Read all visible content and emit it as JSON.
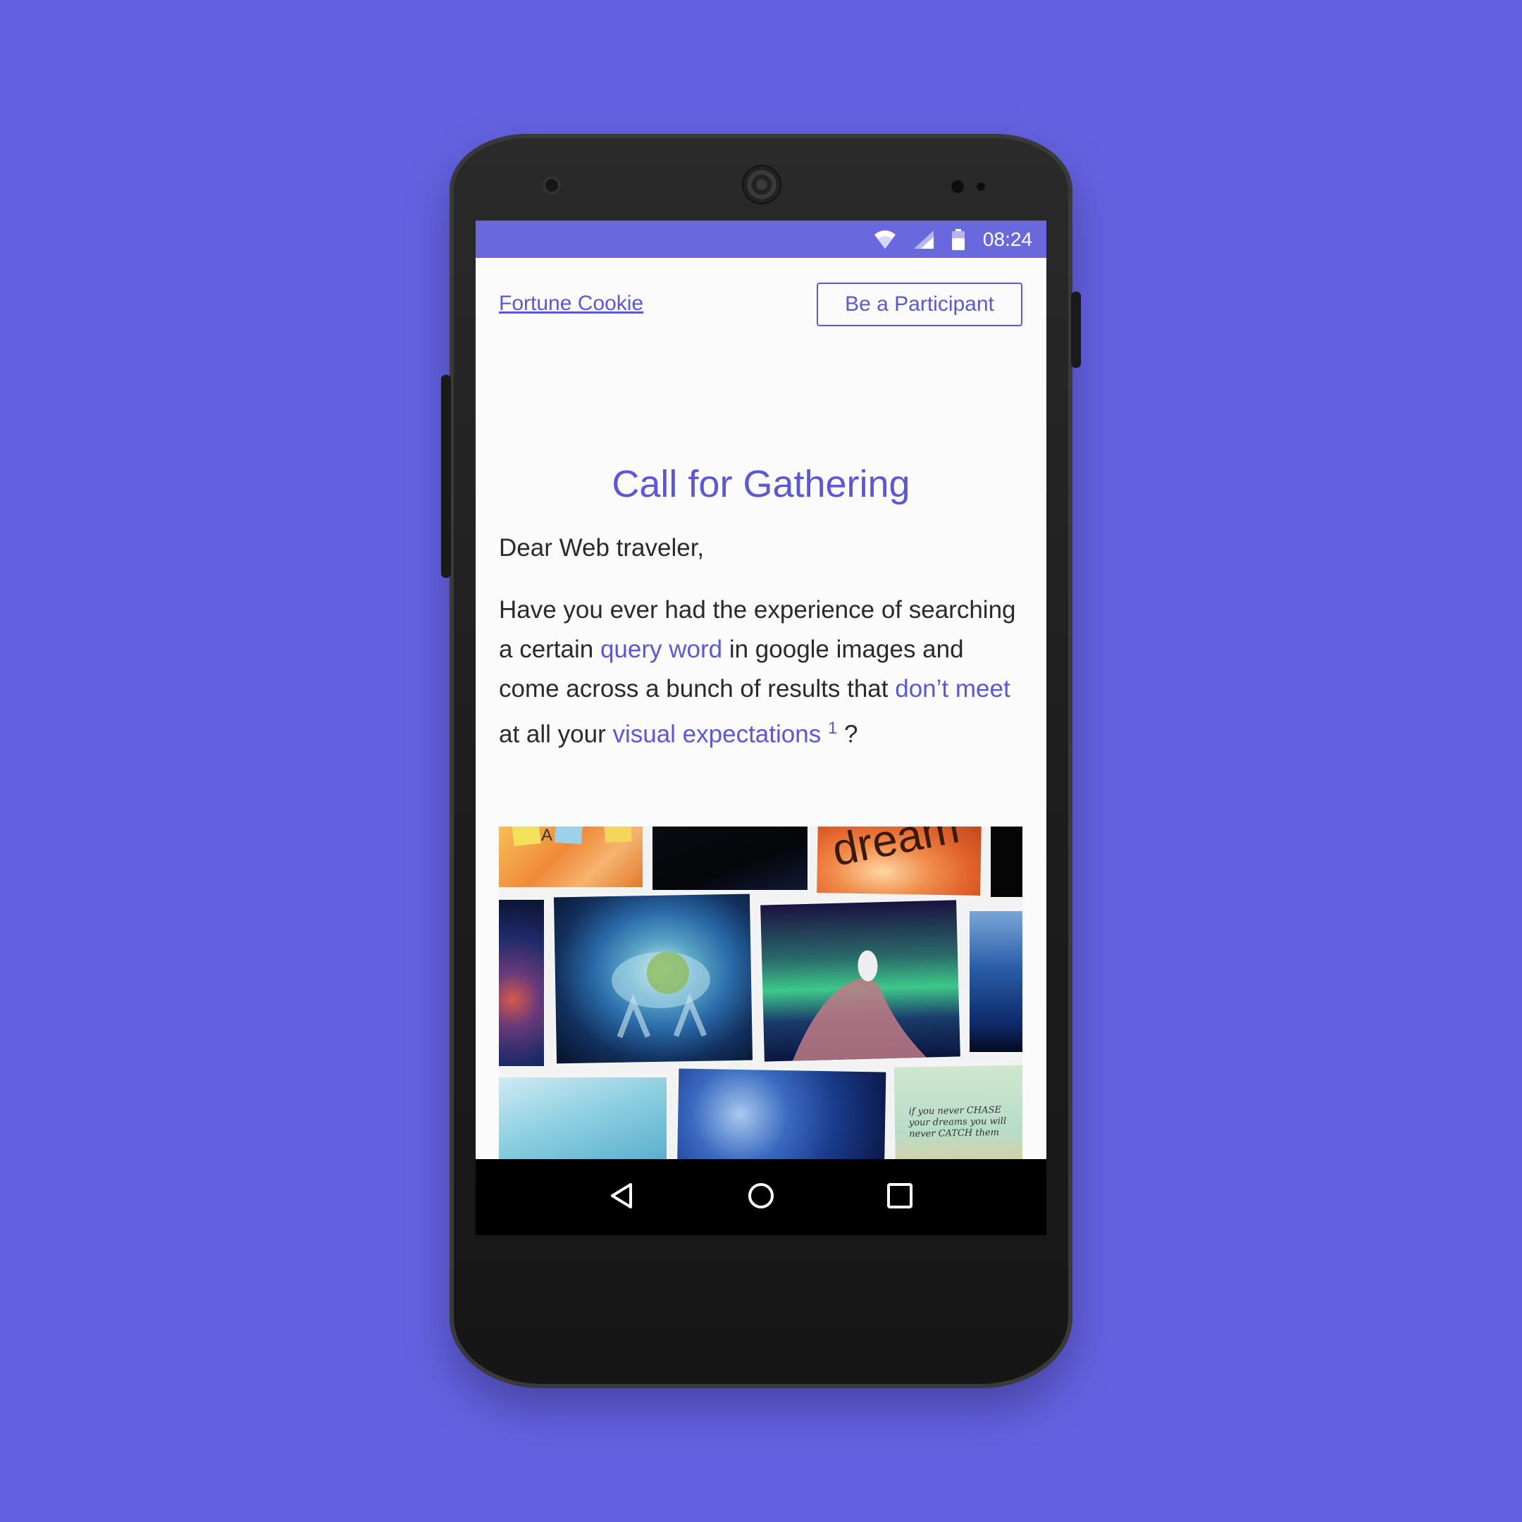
{
  "status_bar": {
    "time": "08:24",
    "icons": [
      "wifi-icon",
      "signal-icon",
      "battery-icon"
    ]
  },
  "nav": {
    "brand": "Fortune Cookie",
    "cta_label": "Be a Participant"
  },
  "article": {
    "title": "Call for Gathering",
    "greeting": "Dear Web traveler,",
    "p1": "Have you ever had the experience of searching a certain ",
    "link_query": "query word",
    "p2": " in google images and come across a bunch of results that ",
    "link_dont_meet": "don’t meet",
    "p3": " at all your ",
    "link_visual": "visual expectations",
    "footnote": "1",
    "p4": " ?"
  },
  "collage": {
    "handwritten_text": "if you never CHASE your dreams you will never CATCH them",
    "word_fragment": "dream"
  },
  "system_nav": {
    "icons": [
      "back-icon",
      "home-icon",
      "recents-icon"
    ]
  },
  "colors": {
    "background": "#6462e0",
    "accent": "#5a58d6",
    "status_bar": "#6a68dd"
  }
}
